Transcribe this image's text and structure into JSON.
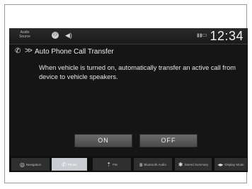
{
  "status_bar": {
    "audio_source_label": "Audio Source",
    "clock": "12:34",
    "icons": [
      "connection-icon",
      "speaker-icon",
      "signal-icon",
      "battery-icon"
    ]
  },
  "header": {
    "icon": "phone-icon",
    "title": "Auto Phone Call Transfer"
  },
  "body": {
    "description": "When vehicle is turned on, automatically transfer an active call from device to vehicle speakers."
  },
  "buttons": {
    "on_label": "ON",
    "off_label": "OFF"
  },
  "bottom_bar": {
    "tabs": [
      {
        "label": "Navigation",
        "icon": "navigation-icon"
      },
      {
        "label": "Phone",
        "icon": "phone-icon",
        "selected": true
      },
      {
        "label": "FM",
        "icon": "radio-icon"
      },
      {
        "label": "Bluetooth Audio",
        "icon": "bluetooth-icon"
      },
      {
        "label": "Stored Summary",
        "icon": "stored-icon"
      },
      {
        "label": "Display Mode",
        "icon": "display-icon"
      }
    ]
  }
}
